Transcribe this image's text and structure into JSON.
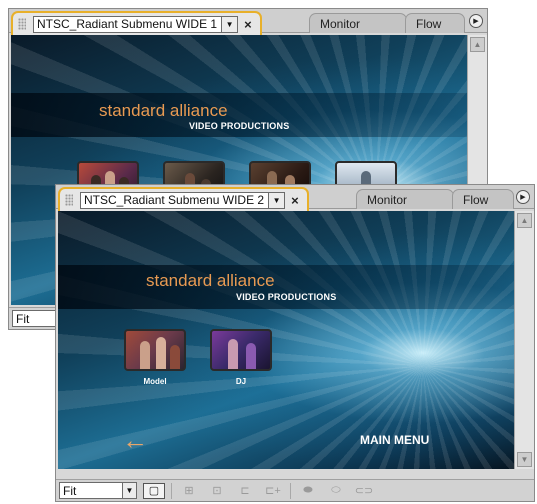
{
  "back_panel": {
    "tab_title": "NTSC_Radiant Submenu WIDE 1",
    "tabs": [
      "Monitor",
      "Flow"
    ],
    "menu": {
      "brand": "standard alliance",
      "subbrand": "VIDEO PRODUCTIONS"
    },
    "zoom": "Fit"
  },
  "front_panel": {
    "tab_title": "NTSC_Radiant Submenu WIDE 2",
    "tabs": [
      "Monitor",
      "Flow"
    ],
    "menu": {
      "brand": "standard alliance",
      "subbrand": "VIDEO PRODUCTIONS",
      "buttons": [
        {
          "label": "Model"
        },
        {
          "label": "DJ"
        }
      ],
      "main_menu": "MAIN MENU"
    },
    "zoom": "Fit"
  },
  "icons": {
    "close": "×",
    "dropdown": "▼",
    "flyout": "▶",
    "back_arrow": "←"
  },
  "colors": {
    "active_tab_border": "#e8b02a",
    "brand_text": "#e89a52",
    "menu_background": "#1d6e94"
  }
}
